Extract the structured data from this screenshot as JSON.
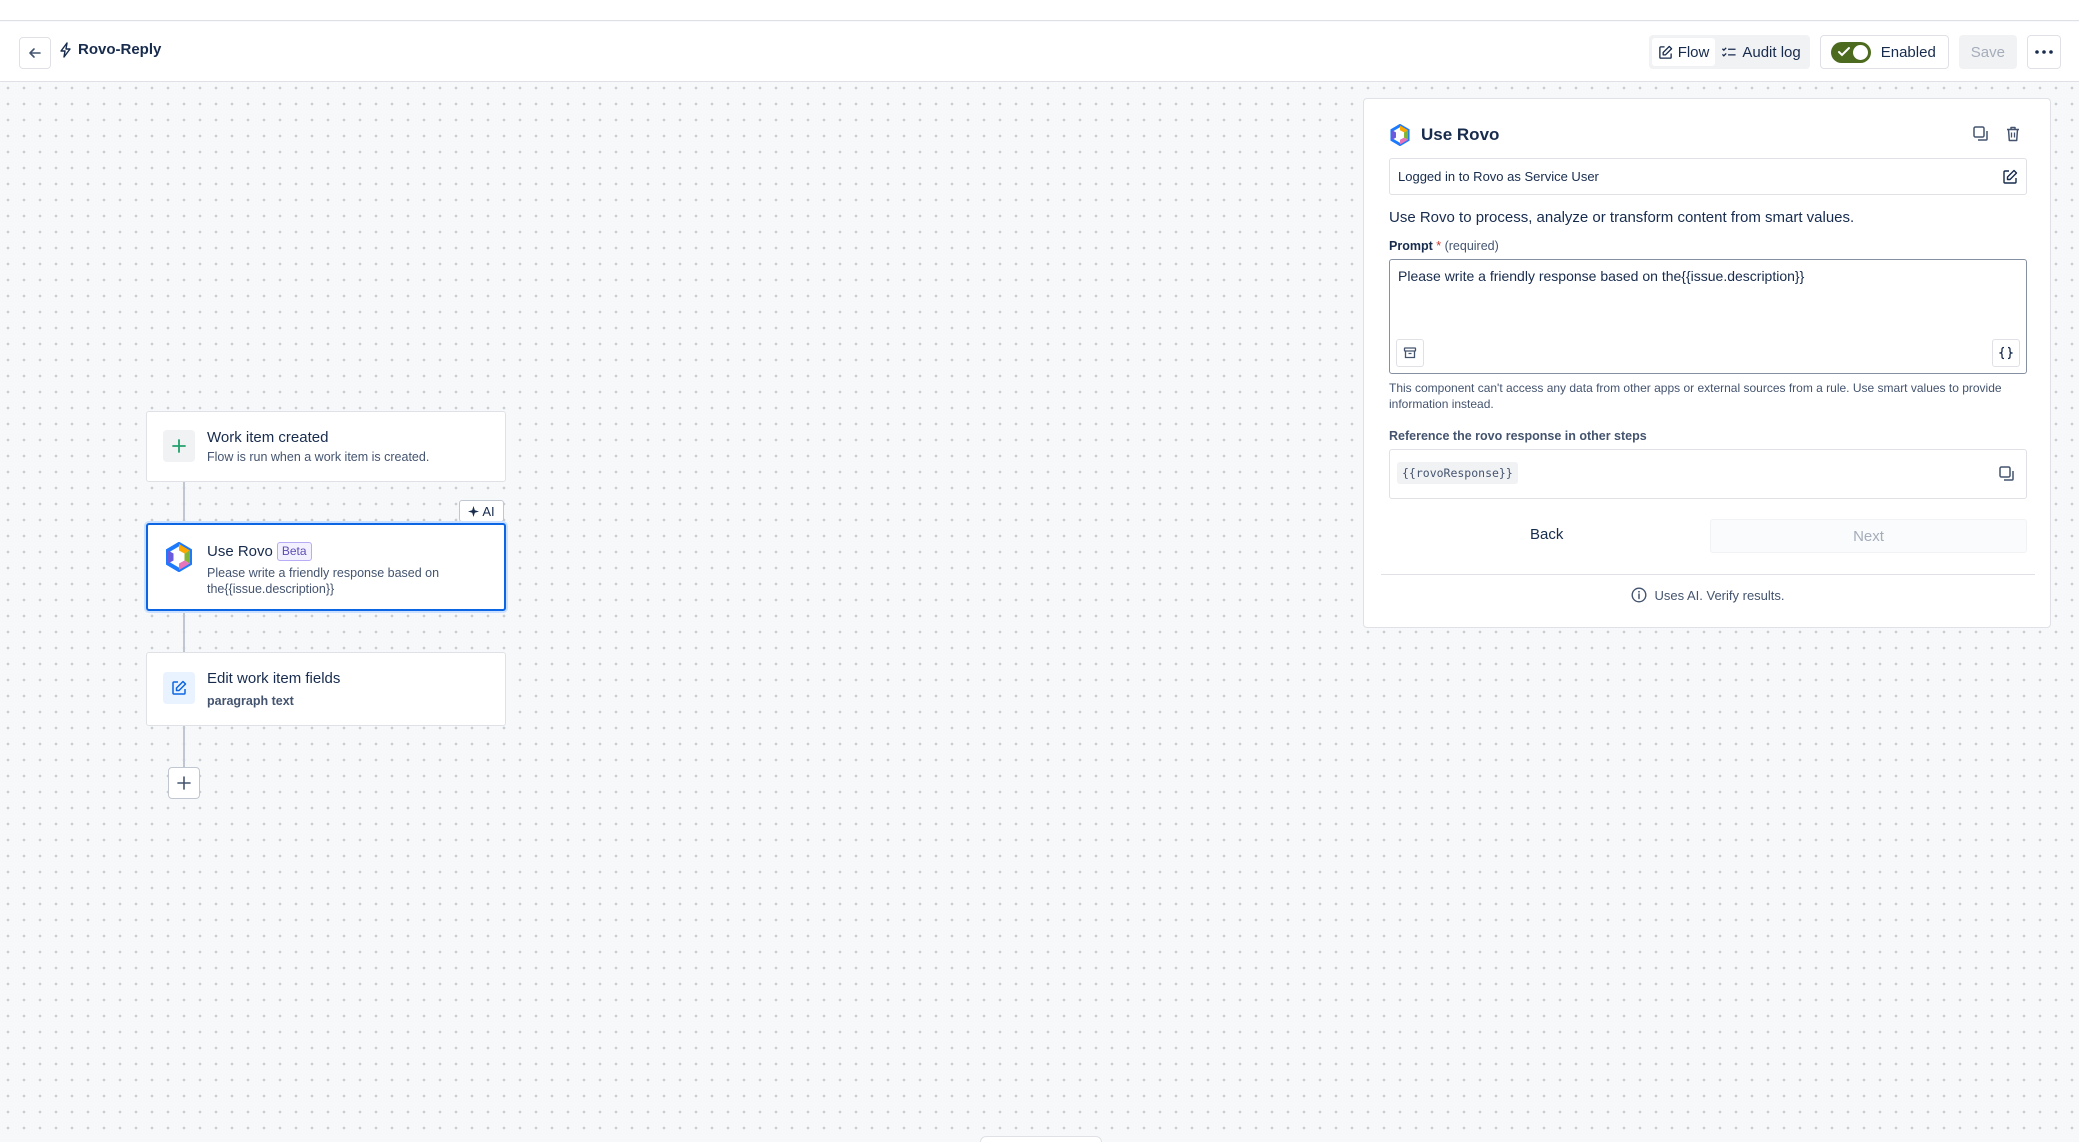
{
  "header": {
    "title": "Rovo-Reply",
    "tabs": [
      {
        "label": "Flow",
        "icon": "edit-icon"
      },
      {
        "label": "Audit log",
        "icon": "list-check-icon"
      }
    ],
    "toggle_label": "Enabled",
    "save_label": "Save"
  },
  "flow": {
    "trigger": {
      "title": "Work item created",
      "subtitle": "Flow is run when a work item is created."
    },
    "ai_tag": "AI",
    "rovo_step": {
      "title": "Use Rovo",
      "badge": "Beta",
      "subtitle": "Please write a friendly response based on the{{issue.description}}"
    },
    "edit_step": {
      "title": "Edit work item fields",
      "subtitle": "paragraph text"
    }
  },
  "panel": {
    "title": "Use Rovo",
    "login_text": "Logged in to Rovo as Service User",
    "description": "Use Rovo to process, analyze or transform content from smart values.",
    "prompt_label": "Prompt",
    "prompt_required_mark": "*",
    "prompt_required_text": "(required)",
    "prompt_value": "Please write a friendly response based on the{{issue.description}}",
    "hint": "This component can't access any data from other apps or external sources from a rule. Use smart values to provide information instead.",
    "ref_label": "Reference the rovo response in other steps",
    "ref_value": "{{rovoResponse}}",
    "back_label": "Back",
    "next_label": "Next",
    "footer_note": "Uses AI. Verify results."
  },
  "colors": {
    "accent": "#0c66e4",
    "toggle_on": "#4c6b1f",
    "trigger_green": "#22a06b"
  }
}
